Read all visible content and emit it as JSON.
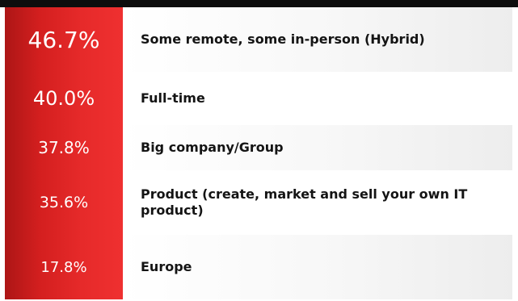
{
  "chart_data": {
    "type": "table",
    "rows": [
      {
        "value": 46.7,
        "display": "46.7%",
        "label": "Some remote, some in-person (Hybrid)"
      },
      {
        "value": 40.0,
        "display": "40.0%",
        "label": "Full-time"
      },
      {
        "value": 37.8,
        "display": "37.8%",
        "label": "Big company/Group"
      },
      {
        "value": 35.6,
        "display": "35.6%",
        "label": "Product (create, market and sell your own IT product)"
      },
      {
        "value": 17.8,
        "display": "17.8%",
        "label": "Europe"
      }
    ]
  },
  "colors": {
    "accent_red": "#e62a2a",
    "top_rule": "#0d0d0d",
    "text_dark": "#141414"
  }
}
